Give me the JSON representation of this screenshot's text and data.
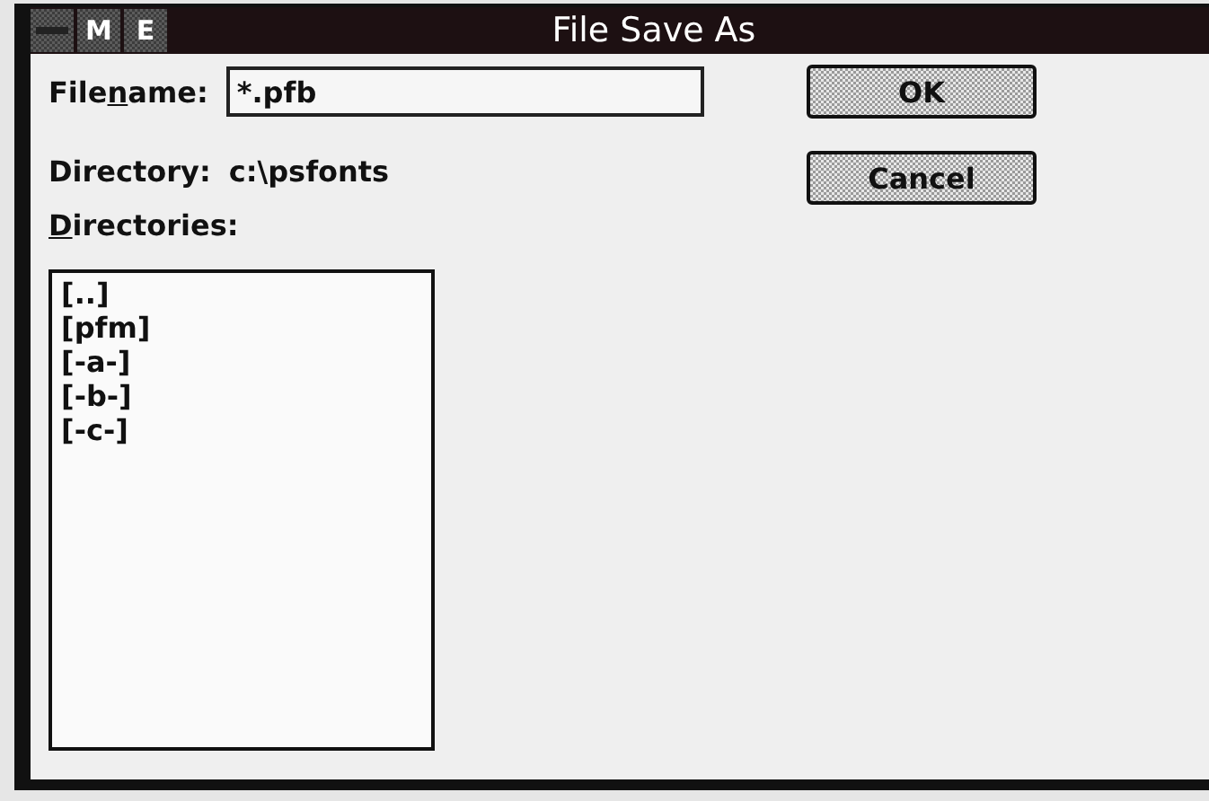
{
  "window": {
    "title": "File Save As",
    "title_buttons": [
      "M",
      "E"
    ]
  },
  "filename": {
    "label": {
      "before": "File",
      "key": "n",
      "after": "ame:"
    },
    "value": "*.pfb"
  },
  "directory": {
    "label": "Directory:",
    "value": "c:\\psfonts"
  },
  "directories": {
    "label": {
      "key": "D",
      "after": "irectories:"
    },
    "items": [
      "[..]",
      "[pfm]",
      "[-a-]",
      "[-b-]",
      "[-c-]"
    ]
  },
  "buttons": [
    "OK",
    "Cancel"
  ]
}
